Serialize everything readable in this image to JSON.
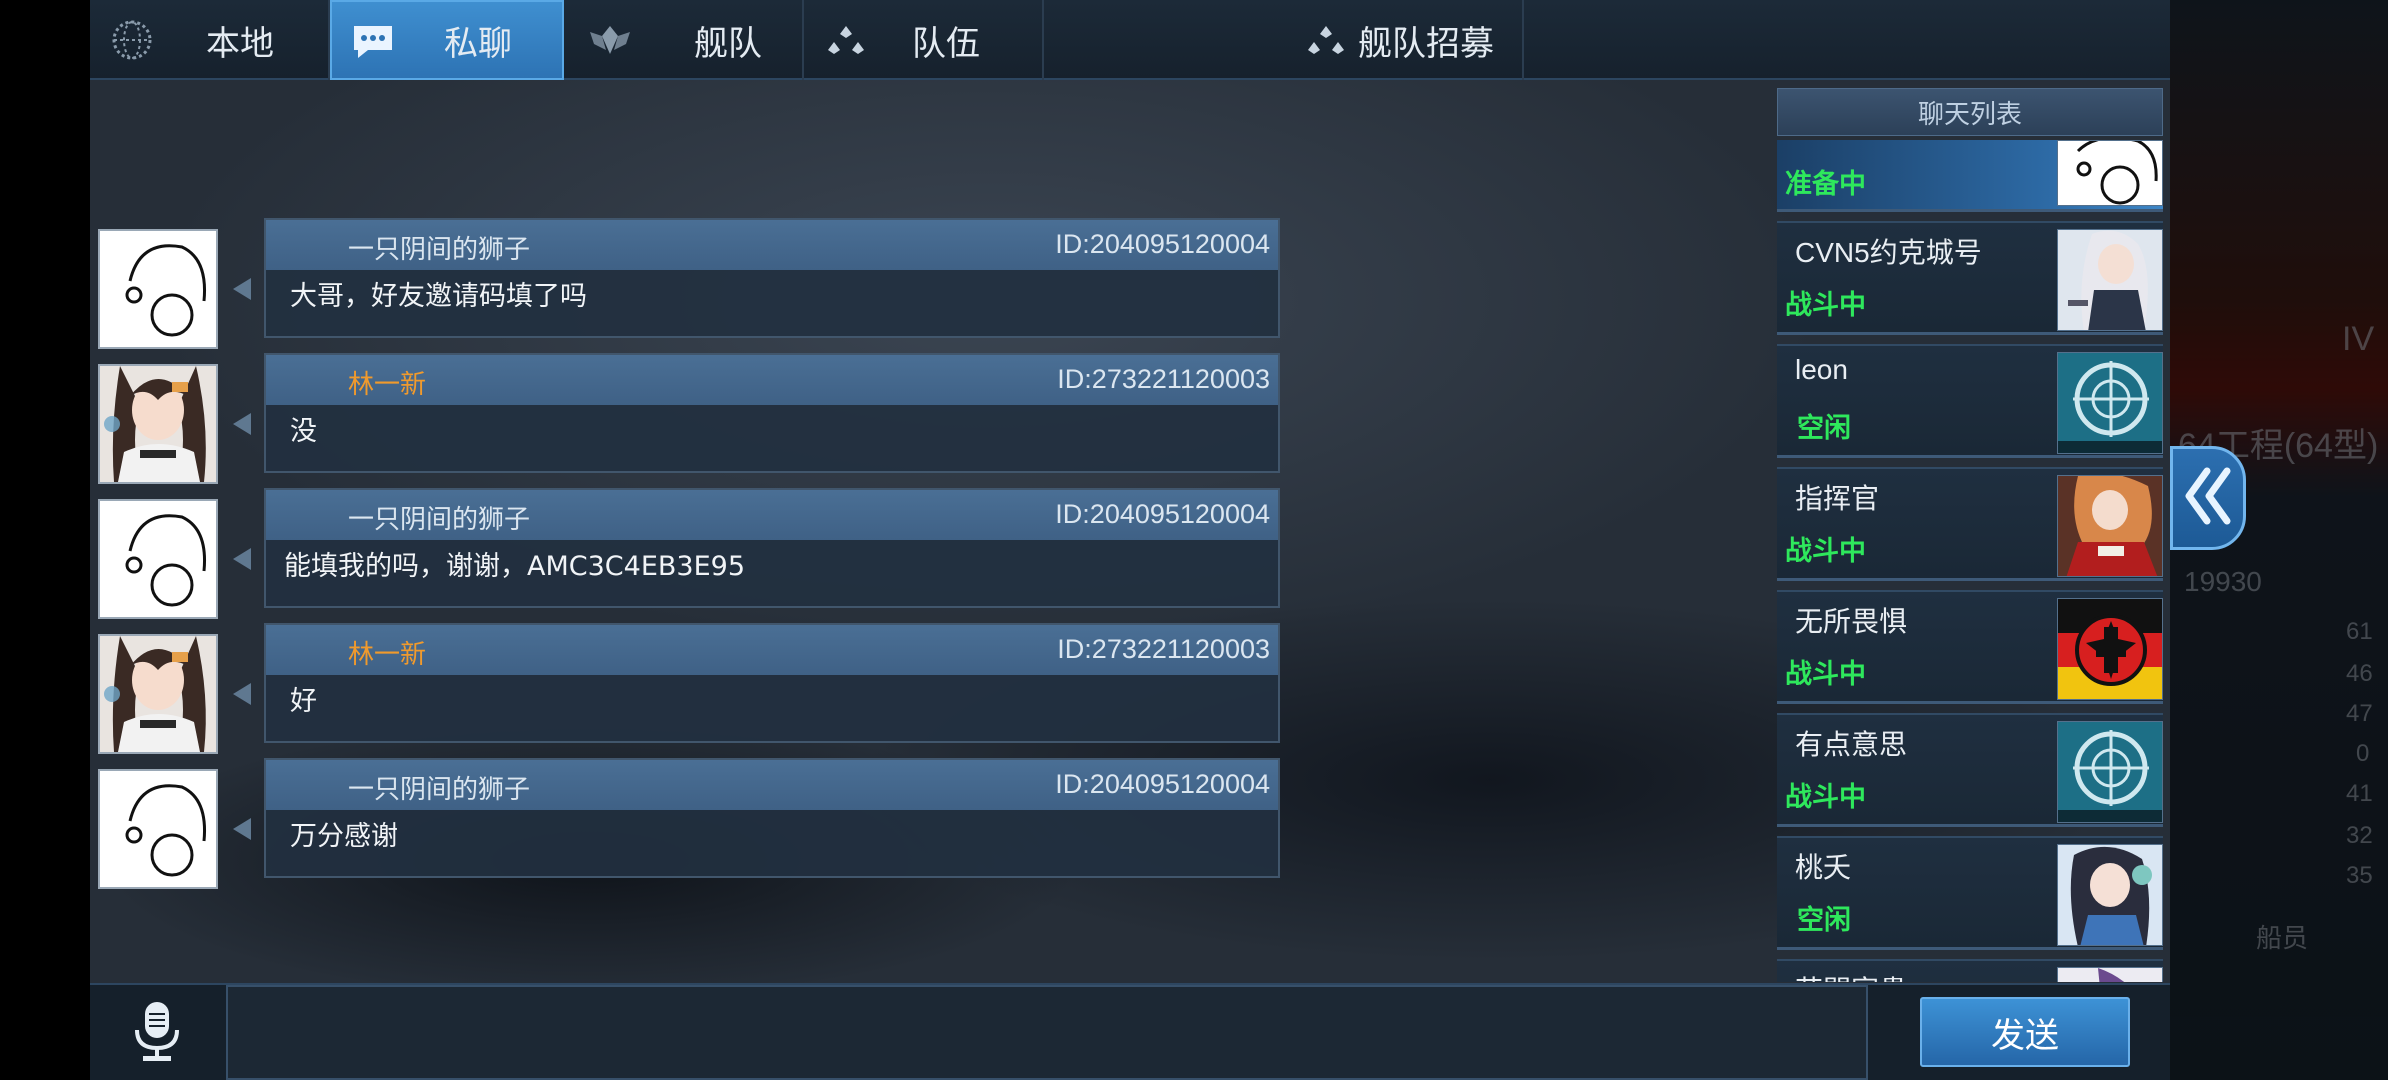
{
  "tabs": [
    {
      "label": "本地",
      "icon": "globe-icon"
    },
    {
      "label": "私聊",
      "icon": "chat-bubble-icon",
      "active": true
    },
    {
      "label": "舰队",
      "icon": "fleet-emblem-icon"
    },
    {
      "label": "队伍",
      "icon": "team-dots-icon"
    },
    {
      "label": "舰队招募",
      "icon": "recruit-dots-icon"
    }
  ],
  "messages": [
    {
      "sender": "一只阴间的狮子",
      "id": "ID:204095120004",
      "text": "大哥，好友邀请码填了吗",
      "avatar": "doodle-avatar"
    },
    {
      "sender": "林一新",
      "id": "ID:273221120003",
      "text": "没",
      "avatar": "anime-girl-avatar"
    },
    {
      "sender": "一只阴间的狮子",
      "id": "ID:204095120004",
      "text": "能填我的吗，谢谢，AMC3C4EB3E95",
      "avatar": "doodle-avatar"
    },
    {
      "sender": "林一新",
      "id": "ID:273221120003",
      "text": "好",
      "avatar": "anime-girl-avatar"
    },
    {
      "sender": "一只阴间的狮子",
      "id": "ID:204095120004",
      "text": "万分感谢",
      "avatar": "doodle-avatar"
    }
  ],
  "chat_list": {
    "title": "聊天列表",
    "contacts": [
      {
        "name": "",
        "status": "准备中",
        "avatar": "doodle-avatar"
      },
      {
        "name": "CVN5约克城号",
        "status": "战斗中",
        "avatar": "anime-shipgirl-avatar"
      },
      {
        "name": "leon",
        "status": "空闲",
        "avatar": "naval-crosshair-emblem"
      },
      {
        "name": "指挥官",
        "status": "战斗中",
        "avatar": "anime-red-dress-avatar"
      },
      {
        "name": "无所畏惧",
        "status": "战斗中",
        "avatar": "iron-cross-flag-avatar"
      },
      {
        "name": "有点意思",
        "status": "战斗中",
        "avatar": "naval-crosshair-emblem"
      },
      {
        "name": "桃夭",
        "status": "空闲",
        "avatar": "anime-dark-hair-avatar"
      },
      {
        "name": "花開富貴",
        "status": "",
        "avatar": "anime-purple-avatar"
      }
    ]
  },
  "input": {
    "placeholder": "",
    "value": ""
  },
  "send_label": "发送",
  "side_panel": {
    "numbers": [
      "IV",
      "64工程(64型)",
      "19930",
      "61",
      "46",
      "47",
      "0",
      "41",
      "32",
      "35"
    ],
    "button_label": "船员"
  }
}
